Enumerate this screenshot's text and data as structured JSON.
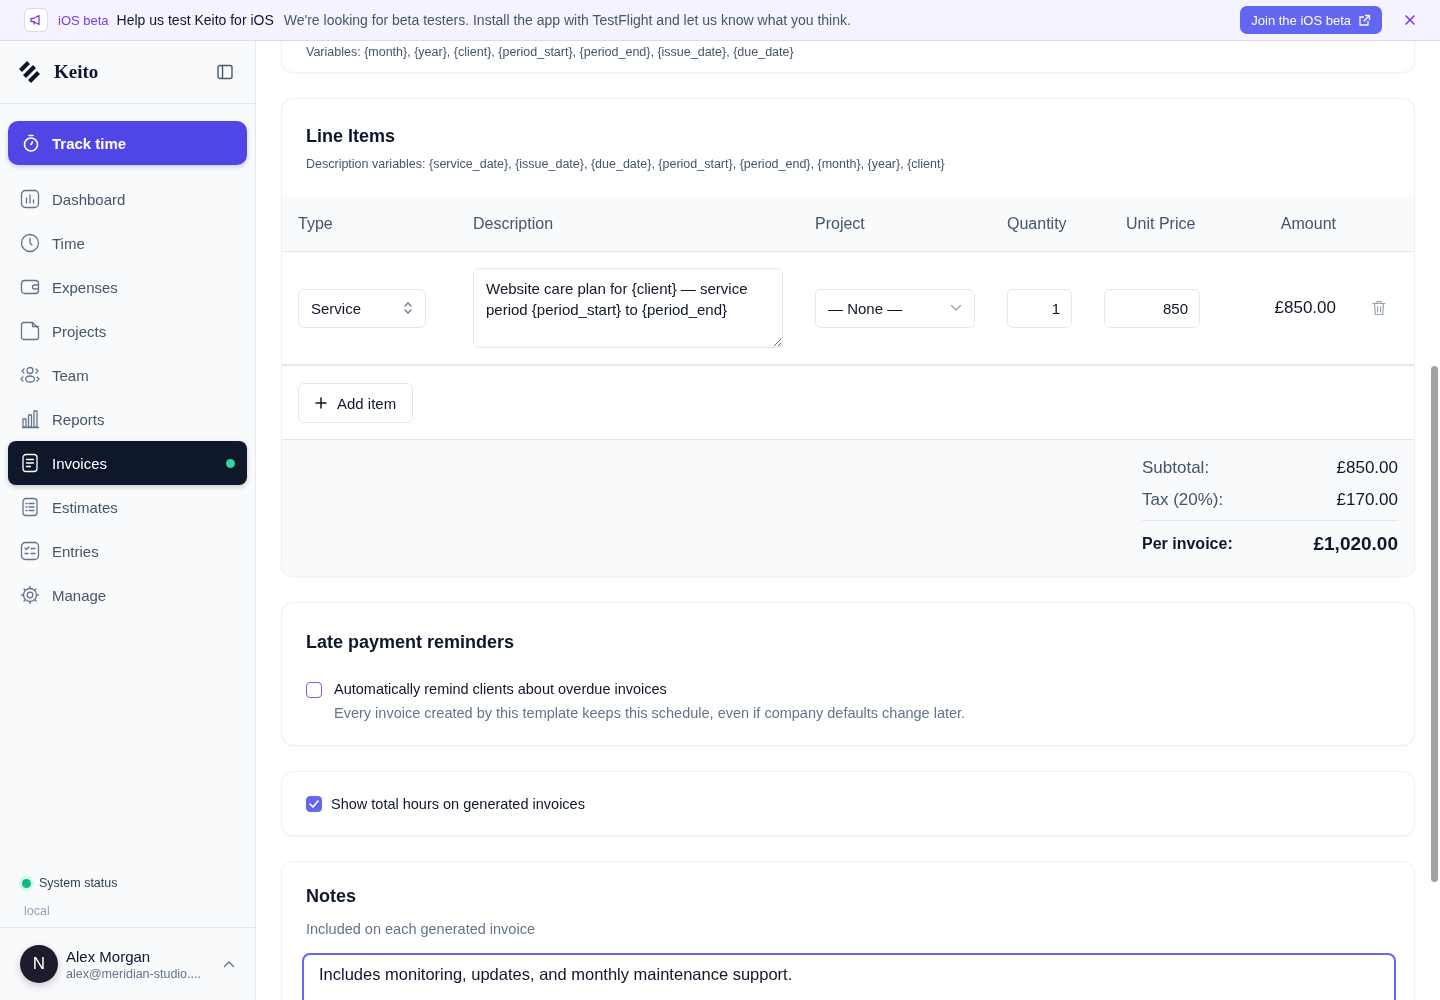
{
  "banner": {
    "tag": "iOS beta",
    "title": "Help us test Keito for iOS",
    "message": "We're looking for beta testers. Install the app with TestFlight and let us know what you think.",
    "button": "Join the iOS beta"
  },
  "sidebar": {
    "brand": "Keito",
    "primary_action": "Track time",
    "items": [
      {
        "label": "Dashboard",
        "selected": false,
        "notification": false
      },
      {
        "label": "Time",
        "selected": false,
        "notification": false
      },
      {
        "label": "Expenses",
        "selected": false,
        "notification": false
      },
      {
        "label": "Projects",
        "selected": false,
        "notification": false
      },
      {
        "label": "Team",
        "selected": false,
        "notification": false
      },
      {
        "label": "Reports",
        "selected": false,
        "notification": false
      },
      {
        "label": "Invoices",
        "selected": true,
        "notification": true
      },
      {
        "label": "Estimates",
        "selected": false,
        "notification": false
      },
      {
        "label": "Entries",
        "selected": false,
        "notification": false
      },
      {
        "label": "Manage",
        "selected": false,
        "notification": false
      }
    ],
    "status": {
      "label": "System status",
      "environment": "local"
    },
    "user": {
      "initial": "N",
      "name": "Alex Morgan",
      "email": "alex@meridian-studio...."
    }
  },
  "top_card": {
    "text": "Variables: {month}, {year}, {client}, {period_start}, {period_end}, {issue_date}, {due_date}"
  },
  "line_items": {
    "title": "Line Items",
    "description": "Description variables: {service_date}, {issue_date}, {due_date}, {period_start}, {period_end}, {month}, {year}, {client}",
    "columns": [
      "Type",
      "Description",
      "Project",
      "Quantity",
      "Unit Price",
      "Amount"
    ],
    "rows": [
      {
        "type": "Service",
        "description": "Website care plan for {client} — service period {period_start} to {period_end}",
        "project": "— None —",
        "quantity": "1",
        "unit_price": "850",
        "amount": "£850.00"
      }
    ],
    "add_button": "Add item",
    "totals": [
      {
        "label": "Subtotal:",
        "value": "£850.00",
        "kind": "line"
      },
      {
        "label": "Tax (20%):",
        "value": "£170.00",
        "kind": "line"
      },
      {
        "label": "Per invoice:",
        "value": "£1,020.00",
        "kind": "total"
      }
    ]
  },
  "reminders": {
    "title": "Late payment reminders",
    "option": {
      "label": "Automatically remind clients about overdue invoices",
      "hint": "Every invoice created by this template keeps this schedule, even if company defaults change later.",
      "checked": false
    }
  },
  "show_hours": {
    "label": "Show total hours on generated invoices",
    "checked": true
  },
  "notes": {
    "title": "Notes",
    "subtitle": "Included on each generated invoice",
    "value": "Includes monitoring, updates, and monthly maintenance support."
  }
}
